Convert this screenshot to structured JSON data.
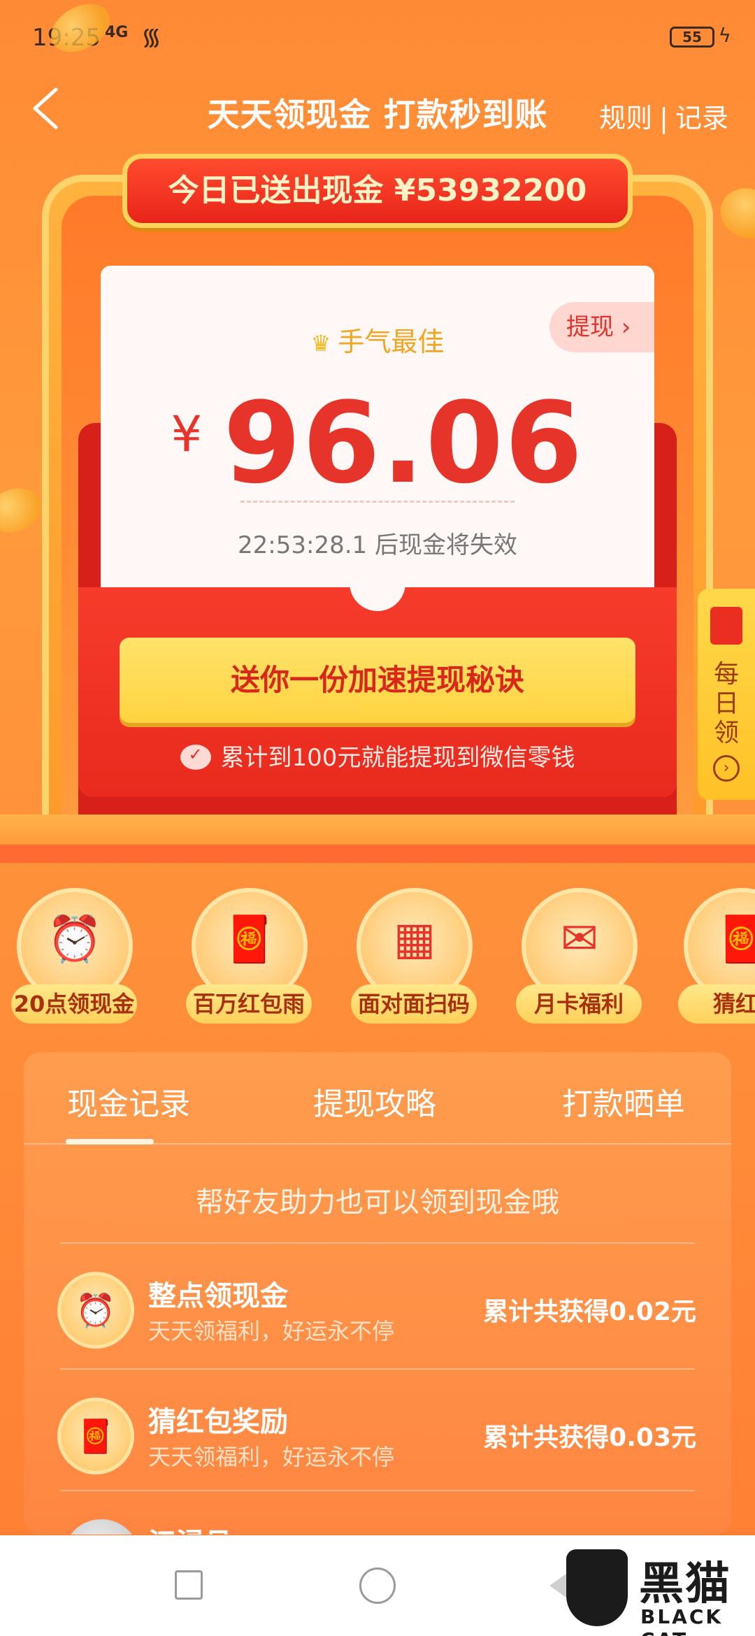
{
  "status_bar": {
    "time": "19:25",
    "signal": "4G",
    "battery": "55"
  },
  "header": {
    "title": "天天领现金 打款秒到账",
    "rules_link": "规则",
    "separator": "|",
    "records_link": "记录"
  },
  "banner": {
    "text": "今日已送出现金 ¥53932200"
  },
  "card": {
    "withdraw_label": "提现",
    "best_label": "手气最佳",
    "currency": "¥",
    "amount": "96.06",
    "expire_text": "22:53:28.1 后现金将失效"
  },
  "cta": {
    "label": "送你一份加速提现秘诀"
  },
  "wechat_note": "累计到100元就能提现到微信零钱",
  "side_tab": {
    "label": "每日领"
  },
  "features": [
    {
      "label": "20点领现金",
      "icon": "alarm-clock-icon"
    },
    {
      "label": "百万红包雨",
      "icon": "red-envelope-icon"
    },
    {
      "label": "面对面扫码",
      "icon": "qr-code-icon"
    },
    {
      "label": "月卡福利",
      "icon": "envelope-open-icon"
    },
    {
      "label": "猜红",
      "icon": "red-envelope-icon"
    }
  ],
  "panel": {
    "tabs": [
      "现金记录",
      "提现攻略",
      "打款晒单"
    ],
    "active_tab": 0,
    "hint": "帮好友助力也可以领到现金哦",
    "records": [
      {
        "title": "整点领现金",
        "subtitle": "天天领福利，好运永不停",
        "amount": "累计共获得0.02元"
      },
      {
        "title": "猜红包奖励",
        "subtitle": "天天领福利，好运永不停",
        "amount": "累计共获得0.03元"
      },
      {
        "title": "江浸月",
        "subtitle": "",
        "amount": ""
      }
    ]
  },
  "watermark": {
    "cn": "黑猫",
    "en": "BLACK CAT"
  },
  "colors": {
    "accent": "#e7342a",
    "gold": "#ffd340",
    "background": "#ff8e3a"
  }
}
